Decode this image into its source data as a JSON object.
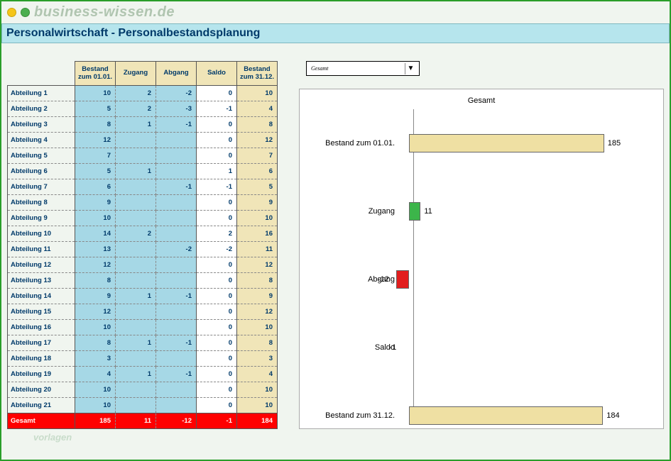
{
  "logo_text": "business-wissen.de",
  "page_title": "Personalwirtschaft - Personalbestandsplanung",
  "dropdown": {
    "selected": "Gesamt"
  },
  "watermark": "vorlagen",
  "table": {
    "headers": {
      "bestand1": "Bestand zum 01.01.",
      "zugang": "Zugang",
      "abgang": "Abgang",
      "saldo": "Saldo",
      "bestand2": "Bestand zum 31.12."
    },
    "rows": [
      {
        "name": "Abteilung 1",
        "bestand1": 10,
        "zugang": 2,
        "abgang": -2,
        "saldo": 0,
        "bestand2": 10
      },
      {
        "name": "Abteilung 2",
        "bestand1": 5,
        "zugang": 2,
        "abgang": -3,
        "saldo": -1,
        "bestand2": 4
      },
      {
        "name": "Abteilung 3",
        "bestand1": 8,
        "zugang": 1,
        "abgang": -1,
        "saldo": 0,
        "bestand2": 8
      },
      {
        "name": "Abteilung 4",
        "bestand1": 12,
        "zugang": "",
        "abgang": "",
        "saldo": 0,
        "bestand2": 12
      },
      {
        "name": "Abteilung 5",
        "bestand1": 7,
        "zugang": "",
        "abgang": "",
        "saldo": 0,
        "bestand2": 7
      },
      {
        "name": "Abteilung 6",
        "bestand1": 5,
        "zugang": 1,
        "abgang": "",
        "saldo": 1,
        "bestand2": 6
      },
      {
        "name": "Abteilung 7",
        "bestand1": 6,
        "zugang": "",
        "abgang": -1,
        "saldo": -1,
        "bestand2": 5
      },
      {
        "name": "Abteilung 8",
        "bestand1": 9,
        "zugang": "",
        "abgang": "",
        "saldo": 0,
        "bestand2": 9
      },
      {
        "name": "Abteilung 9",
        "bestand1": 10,
        "zugang": "",
        "abgang": "",
        "saldo": 0,
        "bestand2": 10
      },
      {
        "name": "Abteilung 10",
        "bestand1": 14,
        "zugang": 2,
        "abgang": "",
        "saldo": 2,
        "bestand2": 16
      },
      {
        "name": "Abteilung 11",
        "bestand1": 13,
        "zugang": "",
        "abgang": -2,
        "saldo": -2,
        "bestand2": 11
      },
      {
        "name": "Abteilung 12",
        "bestand1": 12,
        "zugang": "",
        "abgang": "",
        "saldo": 0,
        "bestand2": 12
      },
      {
        "name": "Abteilung 13",
        "bestand1": 8,
        "zugang": "",
        "abgang": "",
        "saldo": 0,
        "bestand2": 8
      },
      {
        "name": "Abteilung 14",
        "bestand1": 9,
        "zugang": 1,
        "abgang": -1,
        "saldo": 0,
        "bestand2": 9
      },
      {
        "name": "Abteilung 15",
        "bestand1": 12,
        "zugang": "",
        "abgang": "",
        "saldo": 0,
        "bestand2": 12
      },
      {
        "name": "Abteilung 16",
        "bestand1": 10,
        "zugang": "",
        "abgang": "",
        "saldo": 0,
        "bestand2": 10
      },
      {
        "name": "Abteilung 17",
        "bestand1": 8,
        "zugang": 1,
        "abgang": -1,
        "saldo": 0,
        "bestand2": 8
      },
      {
        "name": "Abteilung 18",
        "bestand1": 3,
        "zugang": "",
        "abgang": "",
        "saldo": 0,
        "bestand2": 3
      },
      {
        "name": "Abteilung 19",
        "bestand1": 4,
        "zugang": 1,
        "abgang": -1,
        "saldo": 0,
        "bestand2": 4
      },
      {
        "name": "Abteilung 20",
        "bestand1": 10,
        "zugang": "",
        "abgang": "",
        "saldo": 0,
        "bestand2": 10
      },
      {
        "name": "Abteilung 21",
        "bestand1": 10,
        "zugang": "",
        "abgang": "",
        "saldo": 0,
        "bestand2": 10
      }
    ],
    "total": {
      "name": "Gesamt",
      "bestand1": 185,
      "zugang": 11,
      "abgang": -12,
      "saldo": -1,
      "bestand2": 184
    }
  },
  "chart_data": {
    "type": "bar",
    "orientation": "horizontal",
    "title": "Gesamt",
    "categories": [
      "Bestand zum 01.01.",
      "Zugang",
      "Abgang",
      "Saldo",
      "Bestand zum 31.12."
    ],
    "values": [
      185,
      11,
      -12,
      -1,
      184
    ],
    "colors": [
      "#efe0a3",
      "#3cb54a",
      "#e21d1d",
      "#efe0a3",
      "#efe0a3"
    ],
    "axis_zero_at": 0,
    "range": [
      -20,
      200
    ]
  }
}
